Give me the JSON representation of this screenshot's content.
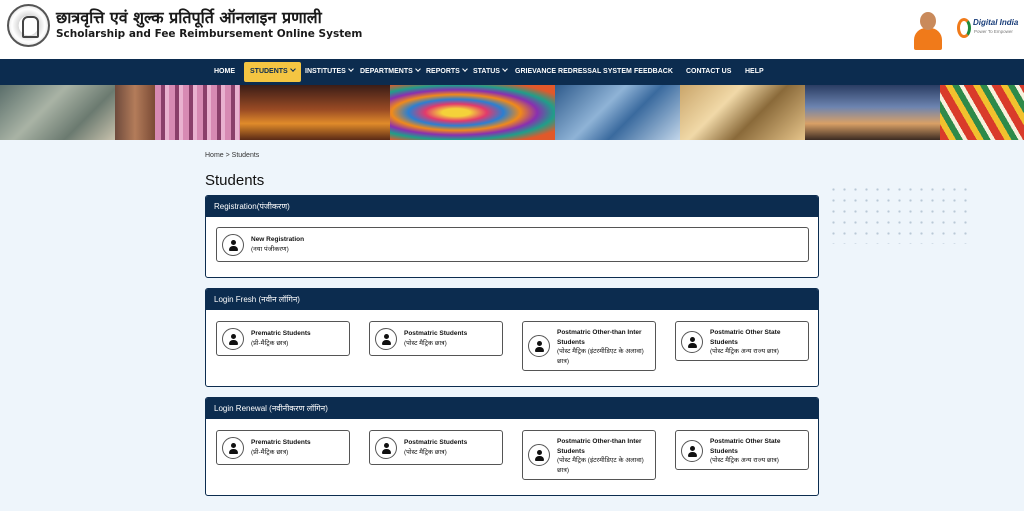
{
  "header": {
    "title_hi": "छात्रवृत्ति एवं शुल्क प्रतिपूर्ति ऑनलाइन प्रणाली",
    "title_en": "Scholarship and Fee Reimbursement Online System",
    "digital_india": "Digital India",
    "digital_india_tagline": "Power To Empower"
  },
  "nav": {
    "items": [
      "HOME",
      "STUDENTS",
      "INSTITUTES",
      "DEPARTMENTS",
      "REPORTS",
      "STATUS",
      "GRIEVANCE REDRESSAL SYSTEM",
      "FEEDBACK",
      "CONTACT US",
      "HELP"
    ],
    "active": "STUDENTS"
  },
  "breadcrumb": "Home > Students",
  "page_title": "Students",
  "panels": [
    {
      "title": "Registration(पंजीकरण)",
      "cards": [
        {
          "title": "New Registration",
          "subtitle": "(नया पंजीकरण)"
        }
      ]
    },
    {
      "title": "Login Fresh (नवीन लॉगिन)",
      "cards": [
        {
          "title": "Prematric Students",
          "subtitle": "(प्री-मैट्रिक छात्र)"
        },
        {
          "title": "Postmatric Students",
          "subtitle": "(पोस्ट मैट्रिक छात्र)"
        },
        {
          "title": "Postmatric Other-than Inter Students",
          "subtitle": "(पोस्ट मैट्रिक (इंटरमीडिएट के अलावा) छात्र)"
        },
        {
          "title": "Postmatric Other State Students",
          "subtitle": "(पोस्ट मैट्रिक अन्य राज्य छात्र)"
        }
      ]
    },
    {
      "title": "Login Renewal (नवीनीकरण लॉगिन)",
      "cards": [
        {
          "title": "Prematric Students",
          "subtitle": "(प्री-मैट्रिक छात्र)"
        },
        {
          "title": "Postmatric Students",
          "subtitle": "(पोस्ट मैट्रिक छात्र)"
        },
        {
          "title": "Postmatric Other-than Inter Students",
          "subtitle": "(पोस्ट मैट्रिक (इंटरमीडिएट के अलावा) छात्र)"
        },
        {
          "title": "Postmatric Other State Students",
          "subtitle": "(पोस्ट मैट्रिक अन्य राज्य छात्र)"
        }
      ]
    }
  ],
  "colors": {
    "nav_bg": "#0c2c4f",
    "active_tab": "#f4c542",
    "page_bg": "#eef5fb"
  }
}
